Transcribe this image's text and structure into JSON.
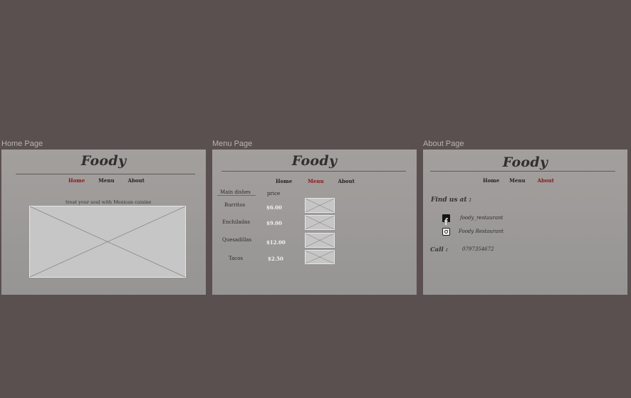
{
  "frames": {
    "home": {
      "label": "Home Page"
    },
    "menu": {
      "label": "Menu Page"
    },
    "about": {
      "label": "About Page"
    }
  },
  "brand": "Foody",
  "nav": {
    "home": "Home",
    "menu": "Menu",
    "about": "About"
  },
  "colors": {
    "active_nav": "#8a1616",
    "canvas": "#5a5050"
  },
  "home": {
    "tagline": "treat your soul with Mexican cuisine",
    "hero_image": "image-placeholder"
  },
  "menu": {
    "dish_header": "Main dishes",
    "price_header": "price",
    "items": [
      {
        "name": "Burritos",
        "price": "$6.00"
      },
      {
        "name": "Enchiladas",
        "price": "$9.00"
      },
      {
        "name": "Quesadillas",
        "price": "$12.00"
      },
      {
        "name": "Tacos",
        "price": "$2.50"
      }
    ]
  },
  "about": {
    "find_us": "Find us at :",
    "facebook": "foody_restaurant",
    "instagram": "Foody Restaurant",
    "call_label": "Call :",
    "phone": "0797354672",
    "icons": {
      "facebook": "facebook-icon",
      "instagram": "instagram-icon"
    }
  }
}
